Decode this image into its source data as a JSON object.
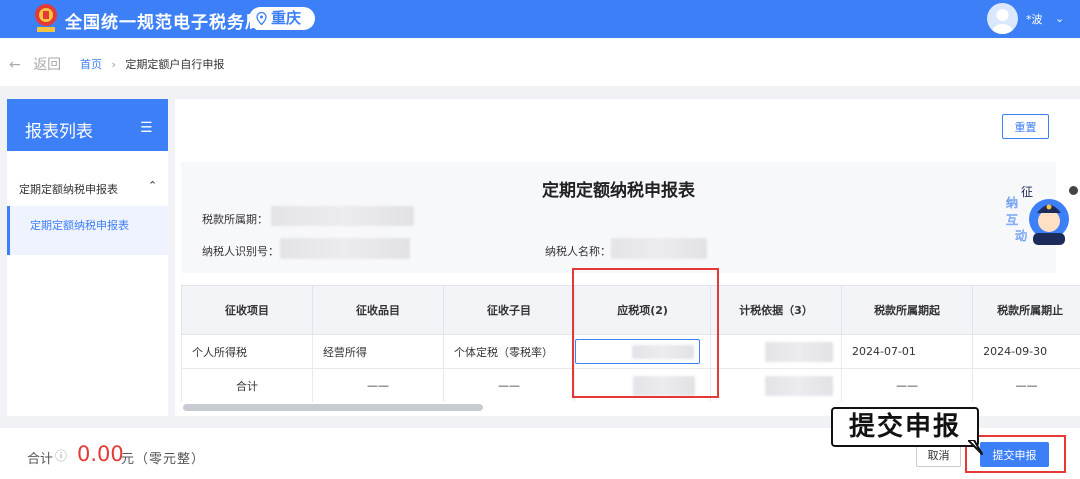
{
  "header": {
    "title": "全国统一规范电子税务局",
    "region": "重庆",
    "username": "*波",
    "brand_color": "#3d7ff6"
  },
  "breadcrumb": {
    "back_label": "返回",
    "home": "首页",
    "separator": "›",
    "current": "定期定额户自行申报"
  },
  "sidebar": {
    "title": "报表列表",
    "group": "定期定额纳税申报表",
    "items": [
      {
        "label": "定期定额纳税申报表"
      }
    ]
  },
  "main": {
    "reset_label": "重置",
    "form_title": "定期定额纳税申报表",
    "fields": {
      "period_label": "税款所属期：",
      "taxpayer_id_label": "纳税人识别号：",
      "taxpayer_name_label": "纳税人名称："
    }
  },
  "mascot": {
    "chars": [
      "征",
      "纳",
      "互",
      "动"
    ]
  },
  "table": {
    "columns": [
      "征收项目",
      "征收品目",
      "征收子目",
      "应税项(2)",
      "计税依据（3）",
      "税款所属期起",
      "税款所属期止"
    ],
    "rows": [
      [
        "个人所得税",
        "经营所得",
        "个体定税（零税率）",
        "",
        "",
        "2024-07-01",
        "2024-09-30"
      ],
      [
        "合计",
        "——",
        "——",
        "",
        "",
        "——",
        "——"
      ]
    ]
  },
  "footer": {
    "total_label": "合计",
    "info_icon": "ⓘ",
    "total_value": "0.00",
    "unit": "元",
    "amount_words": "（零元整）",
    "cancel_label": "取消",
    "submit_label": "提交申报"
  },
  "annotation": {
    "callout_text": "提交申报",
    "highlight_color": "#e53935"
  }
}
